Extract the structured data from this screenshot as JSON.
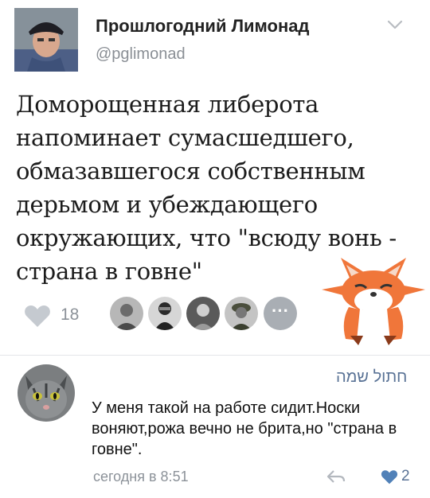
{
  "author": {
    "name": "Прошлогодний Лимонад",
    "handle": "@pglimonad"
  },
  "tweet": {
    "text": "Доморощенная либерота напоминает сумасшедшего, обмазавшегося собственным дерьмом и убеждающего окружающих, что \"всюду вонь - страна в говне\""
  },
  "likes": {
    "count": "18",
    "more_glyph": "···"
  },
  "comment": {
    "author": "חתול שמה",
    "text": "У меня такой на работе сидит.Носки воняют,рожа вечно не брита,но \"страна в говне\".",
    "time": "сегодня в 8:51",
    "likes": "2"
  },
  "icons": {
    "chevron": "chevron-down-icon",
    "like": "heart-icon",
    "reply": "reply-icon",
    "sticker": "fox-sticker"
  },
  "colors": {
    "link": "#5a7396",
    "muted": "#8c9299",
    "heart": "#c5cad0",
    "heart_active": "#5181b8",
    "fox": "#f0763a"
  }
}
